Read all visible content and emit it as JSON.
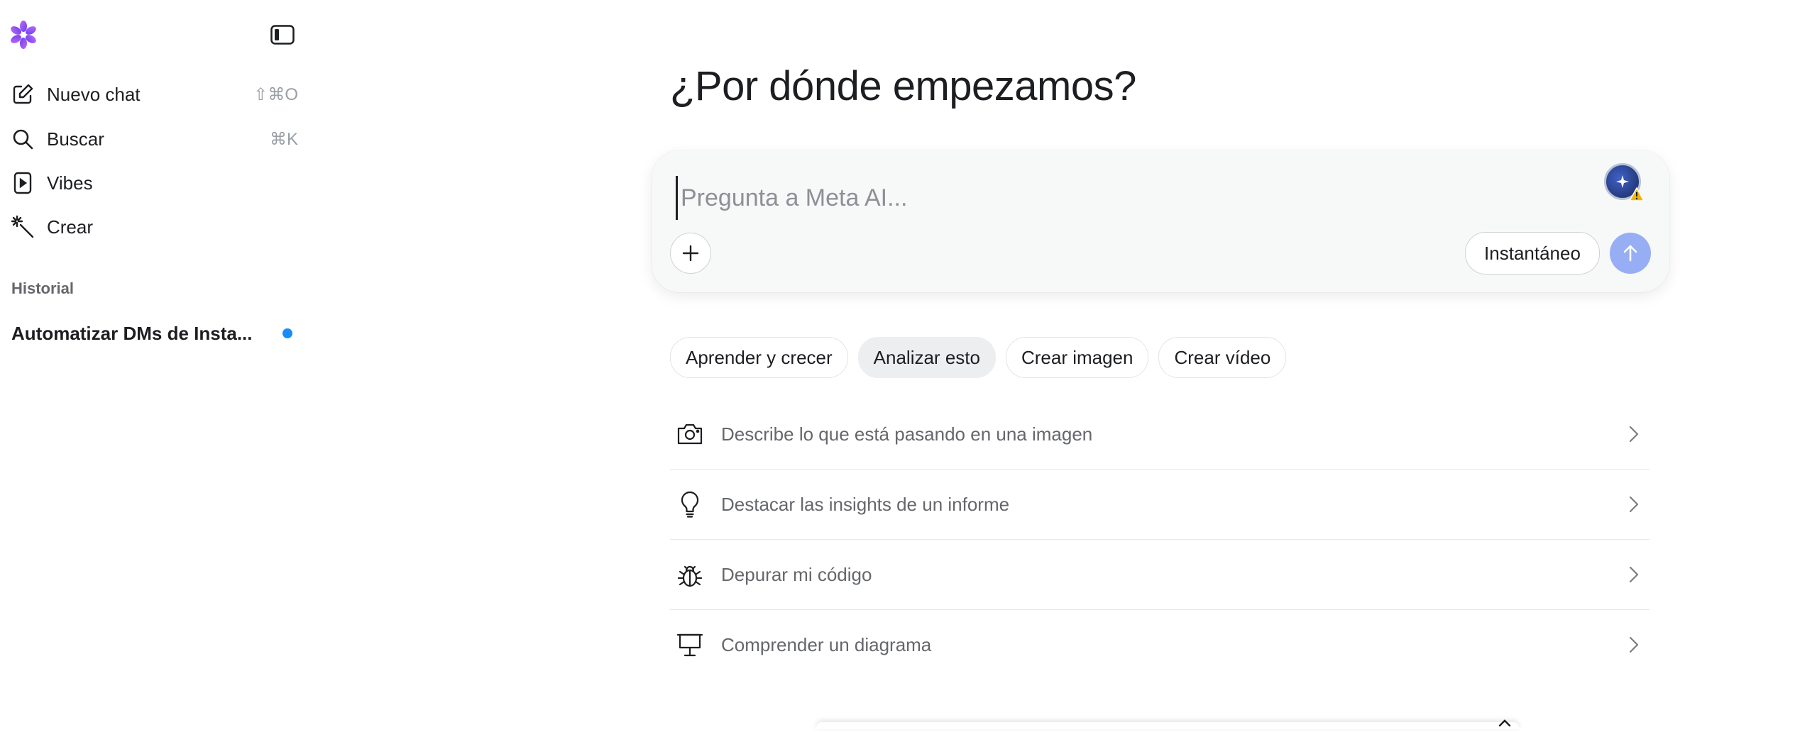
{
  "sidebar": {
    "nav": [
      {
        "label": "Nuevo chat",
        "shortcut": "⇧⌘O",
        "icon": "edit-icon"
      },
      {
        "label": "Buscar",
        "shortcut": "⌘K",
        "icon": "search-icon"
      },
      {
        "label": "Vibes",
        "shortcut": "",
        "icon": "play-icon"
      },
      {
        "label": "Crear",
        "shortcut": "",
        "icon": "magic-wand-icon"
      }
    ],
    "history_title": "Historial",
    "history_items": [
      {
        "label": "Automatizar DMs de Insta...",
        "unread": true
      }
    ]
  },
  "main": {
    "heading": "¿Por dónde empezamos?",
    "composer": {
      "placeholder": "Pregunta a Meta AI...",
      "mode_label": "Instantáneo"
    },
    "chips": [
      {
        "label": "Aprender y crecer",
        "active": false
      },
      {
        "label": "Analizar esto",
        "active": true
      },
      {
        "label": "Crear imagen",
        "active": false
      },
      {
        "label": "Crear vídeo",
        "active": false
      }
    ],
    "suggestions": [
      {
        "label": "Describe lo que está pasando en una imagen",
        "icon": "camera-icon"
      },
      {
        "label": "Destacar las insights de un informe",
        "icon": "lightbulb-icon"
      },
      {
        "label": "Depurar mi código",
        "icon": "bug-icon"
      },
      {
        "label": "Comprender un diagrama",
        "icon": "presentation-icon"
      }
    ]
  },
  "colors": {
    "accent_send": "#97aef5",
    "unread_dot": "#1a8cf5",
    "composer_bg": "#f7f8f8"
  }
}
